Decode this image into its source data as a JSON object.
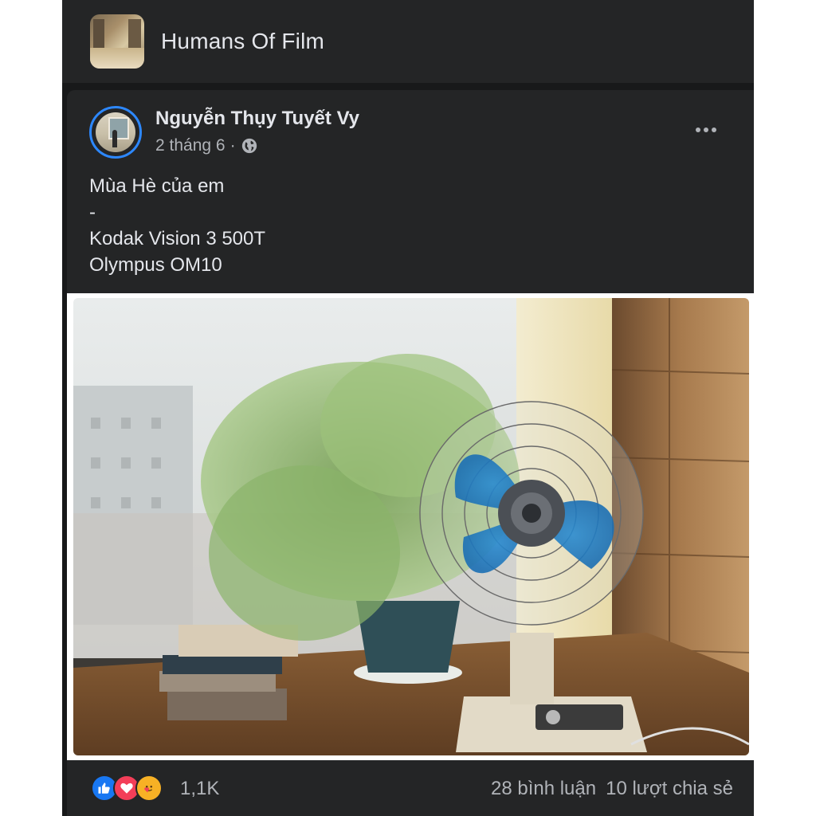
{
  "group": {
    "name": "Humans Of Film"
  },
  "post": {
    "author": "Nguyễn Thụy Tuyết Vy",
    "date": "2 tháng 6",
    "separator": "·",
    "caption_lines": [
      "Mùa Hè của em",
      "-",
      "Kodak Vision 3 500T",
      "Olympus OM10"
    ],
    "reactions": {
      "icons": [
        "like-icon",
        "love-icon",
        "care-icon"
      ],
      "count": "1,1K"
    },
    "comments": "28 bình luận",
    "shares": "10 lượt chia sẻ"
  },
  "colors": {
    "background": "#18191a",
    "card": "#242526",
    "text_primary": "#e4e6eb",
    "text_secondary": "#b0b3b8",
    "like_blue": "#1877f2",
    "love_red": "#f33e58",
    "care_yellow": "#f7b125"
  }
}
